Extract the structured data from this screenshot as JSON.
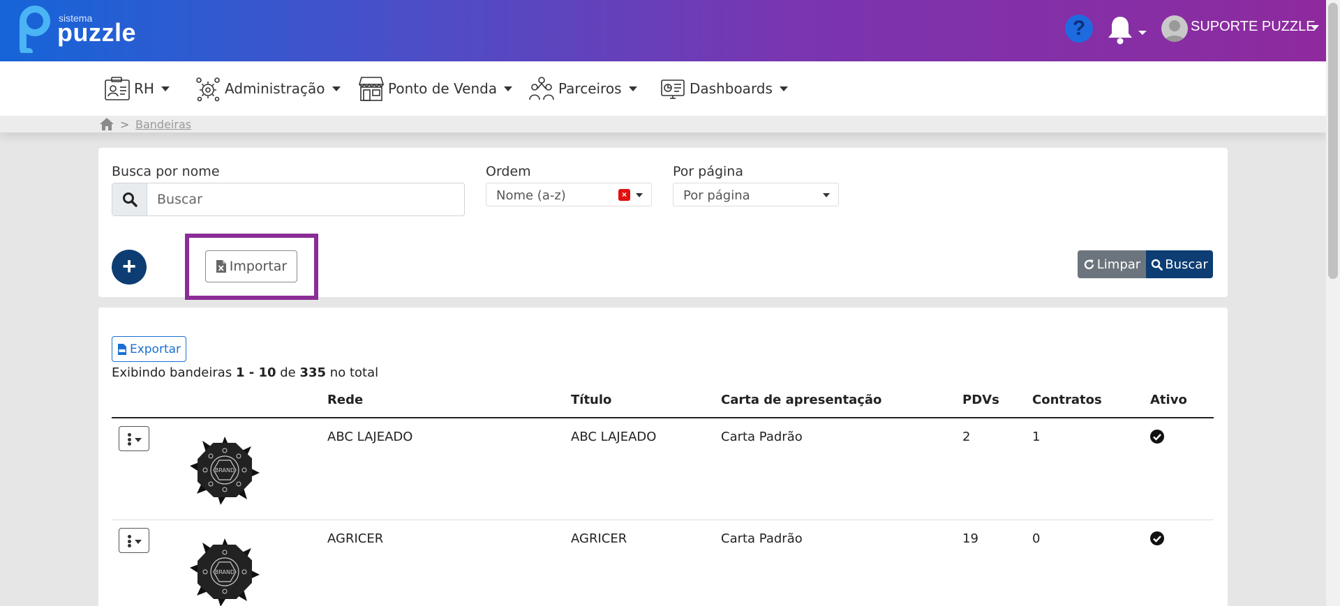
{
  "header": {
    "brand_small": "sistema",
    "brand_big": "puzzle",
    "help_label": "?",
    "user_name": "SUPORTE PUZZLE"
  },
  "nav": {
    "items": [
      {
        "label": "RH",
        "icon": "id-card-icon"
      },
      {
        "label": "Administração",
        "icon": "gears-icon"
      },
      {
        "label": "Ponto de Venda",
        "icon": "store-icon"
      },
      {
        "label": "Parceiros",
        "icon": "people-icon"
      },
      {
        "label": "Dashboards",
        "icon": "monitor-chart-icon"
      }
    ]
  },
  "breadcrumb": {
    "separator": ">",
    "current": "Bandeiras"
  },
  "filters": {
    "search_label": "Busca por nome",
    "search_placeholder": "Buscar",
    "search_value": "",
    "order_label": "Ordem",
    "order_value": "Nome (a-z)",
    "clear_x": "×",
    "per_page_label": "Por página",
    "per_page_value": "Por página",
    "add_label": "+",
    "import_label": "Importar",
    "clear_label": "Limpar",
    "search_button_label": "Buscar"
  },
  "table": {
    "export_label": "Exportar",
    "summary": {
      "prefix": "Exibindo bandeiras",
      "range": "1 - 10",
      "of": "de",
      "total": "335",
      "suffix": "no total"
    },
    "columns": [
      "Rede",
      "Título",
      "Carta de apresentação",
      "PDVs",
      "Contratos",
      "Ativo"
    ],
    "rows": [
      {
        "rede": "ABC LAJEADO",
        "titulo": "ABC LAJEADO",
        "carta": "Carta Padrão",
        "pdvs": "2",
        "contratos": "1",
        "ativo": true,
        "logo_text": "BRAND"
      },
      {
        "rede": "AGRICER",
        "titulo": "AGRICER",
        "carta": "Carta Padrão",
        "pdvs": "19",
        "contratos": "0",
        "ativo": true,
        "logo_text": "BRAND"
      }
    ]
  },
  "colors": {
    "header_gradient_start": "#1565d8",
    "header_gradient_end": "#8e2a9e",
    "primary_dark": "#0d3d73",
    "highlight": "#8b2d96",
    "export_blue": "#1a6fd4",
    "clear_gray": "#6c757d"
  }
}
